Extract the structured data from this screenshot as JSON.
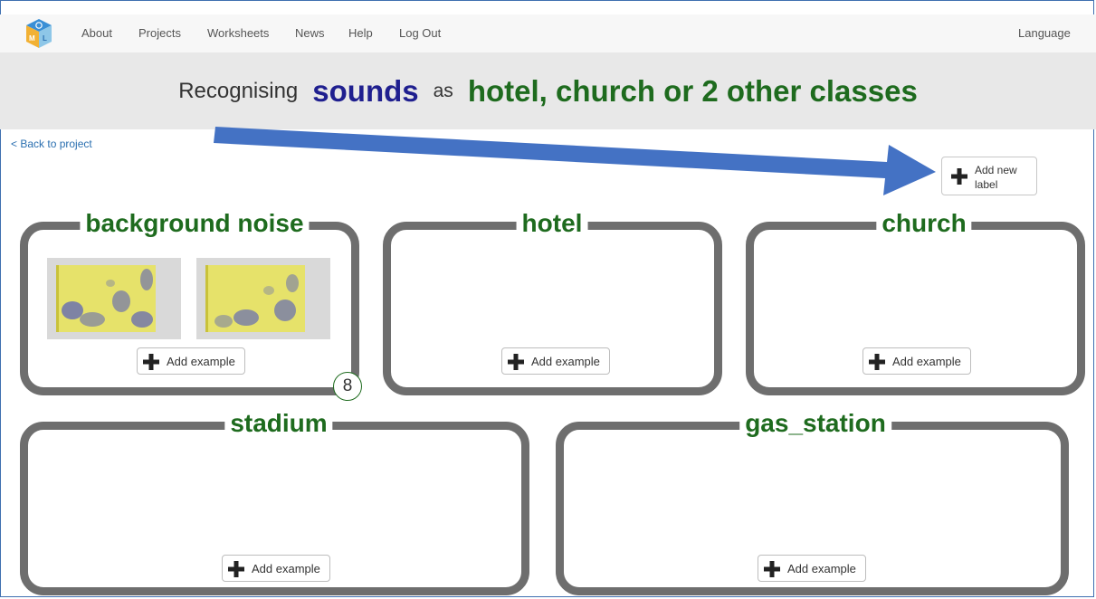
{
  "nav": {
    "items": [
      "About",
      "Projects",
      "Worksheets",
      "News",
      "Help",
      "Log Out"
    ],
    "language": "Language"
  },
  "header": {
    "prefix": "Recognising",
    "data_type": "sounds",
    "connector": "as",
    "classes_text": "hotel, church or 2 other classes"
  },
  "back_link": "< Back to project",
  "add_label_button": "Add new label",
  "add_example_label": "Add example",
  "labels": [
    {
      "name": "background noise",
      "example_count": "8"
    },
    {
      "name": "hotel"
    },
    {
      "name": "church"
    },
    {
      "name": "stadium"
    },
    {
      "name": "gas_station"
    }
  ],
  "colors": {
    "accent_arrow": "#4472c4",
    "label_green": "#1e6b1e",
    "sounds_blue": "#1f1f8f",
    "box_gray": "#6e6e6e",
    "spectrogram_yellow": "#e6e26a",
    "spectrogram_blue": "#5b63b8"
  },
  "icons": [
    "ml-logo-icon",
    "plus-icon"
  ]
}
